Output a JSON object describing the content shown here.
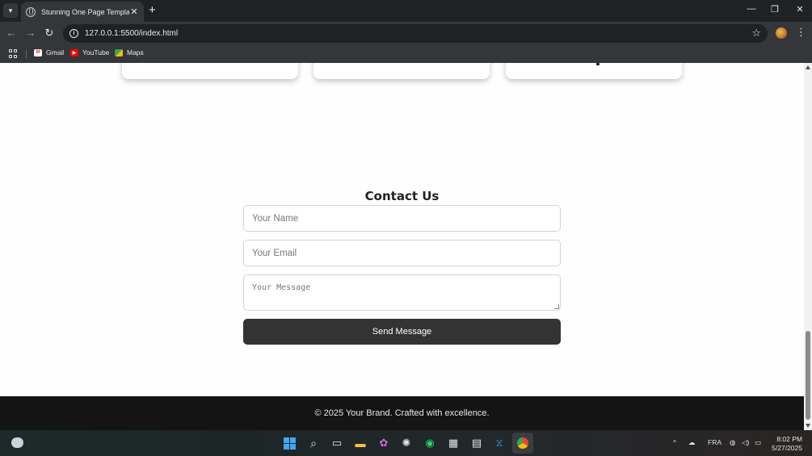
{
  "browser": {
    "tab_title": "Stunning One Page Template",
    "url": "127.0.0.1:5500/index.html",
    "bookmarks": [
      {
        "label": "Gmail",
        "icon": "gmail-icon",
        "color": "#ea4335"
      },
      {
        "label": "YouTube",
        "icon": "youtube-icon",
        "color": "#ff0000"
      },
      {
        "label": "Maps",
        "icon": "maps-icon",
        "color": "#34a853"
      }
    ]
  },
  "page": {
    "contact": {
      "title": "Contact Us",
      "name_placeholder": "Your Name",
      "email_placeholder": "Your Email",
      "message_placeholder": "Your Message",
      "submit_label": "Send Message"
    },
    "footer_text": "© 2025 Your Brand. Crafted with excellence."
  },
  "taskbar": {
    "language": "FRA",
    "time": "8:02 PM",
    "date": "5/27/2025"
  },
  "colors": {
    "button_bg": "#333333",
    "footer_bg": "#141414",
    "page_bg": "#fefefe"
  }
}
